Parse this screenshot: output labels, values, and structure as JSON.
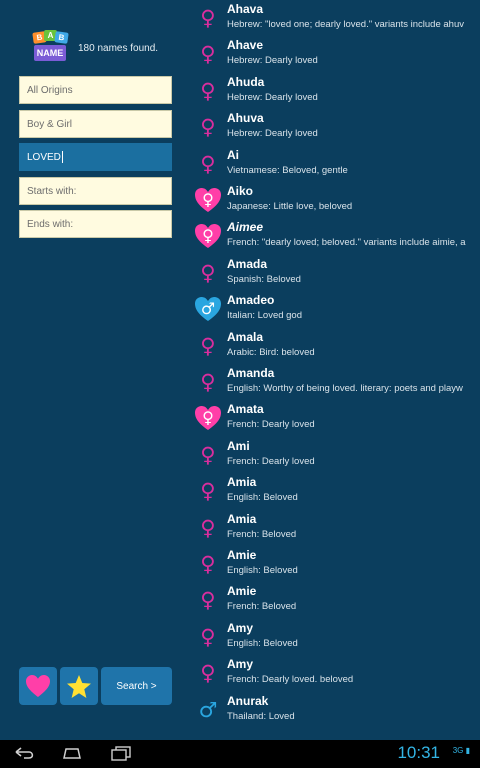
{
  "sidebar": {
    "results_text": "180 names found.",
    "logo_letters": [
      "B",
      "A",
      "B",
      "Y",
      "N",
      "A",
      "M",
      "E"
    ],
    "origin_select": "All Origins",
    "gender_select": "Boy & Girl",
    "meaning_value": "LOVED",
    "starts_placeholder": "Starts with:",
    "ends_placeholder": "Ends with:",
    "search_label": "Search >"
  },
  "names": [
    {
      "name": "Ahava",
      "desc": "Hebrew: \"loved one; dearly loved.\" variants include ahuv",
      "gender": "female",
      "fav": false
    },
    {
      "name": "Ahave",
      "desc": "Hebrew: Dearly loved",
      "gender": "female",
      "fav": false
    },
    {
      "name": "Ahuda",
      "desc": "Hebrew: Dearly loved",
      "gender": "female",
      "fav": false
    },
    {
      "name": "Ahuva",
      "desc": "Hebrew: Dearly loved",
      "gender": "female",
      "fav": false
    },
    {
      "name": "Ai",
      "desc": "Vietnamese: Beloved, gentle",
      "gender": "female",
      "fav": false
    },
    {
      "name": "Aiko",
      "desc": "Japanese: Little love, beloved",
      "gender": "female",
      "fav": true
    },
    {
      "name": "Aimee",
      "desc": "French: \"dearly loved; beloved.\" variants include aimie, a",
      "gender": "female",
      "fav": true
    },
    {
      "name": "Amada",
      "desc": "Spanish: Beloved",
      "gender": "female",
      "fav": false
    },
    {
      "name": "Amadeo",
      "desc": "Italian: Loved god",
      "gender": "male",
      "fav": true
    },
    {
      "name": "Amala",
      "desc": "Arabic: Bird: beloved",
      "gender": "female",
      "fav": false
    },
    {
      "name": "Amanda",
      "desc": "English: Worthy of being loved. literary: poets and playw",
      "gender": "female",
      "fav": false
    },
    {
      "name": "Amata",
      "desc": "French: Dearly loved",
      "gender": "female",
      "fav": true
    },
    {
      "name": "Ami",
      "desc": "French: Dearly loved",
      "gender": "female",
      "fav": false
    },
    {
      "name": "Amia",
      "desc": "English: Beloved",
      "gender": "female",
      "fav": false
    },
    {
      "name": "Amia",
      "desc": "French: Beloved",
      "gender": "female",
      "fav": false
    },
    {
      "name": "Amie",
      "desc": "English: Beloved",
      "gender": "female",
      "fav": false
    },
    {
      "name": "Amie",
      "desc": "French: Beloved",
      "gender": "female",
      "fav": false
    },
    {
      "name": "Amy",
      "desc": "English: Beloved",
      "gender": "female",
      "fav": false
    },
    {
      "name": "Amy",
      "desc": "French: Dearly loved. beloved",
      "gender": "female",
      "fav": false
    },
    {
      "name": "Anurak",
      "desc": "Thailand: Loved",
      "gender": "male",
      "fav": false
    }
  ],
  "colors": {
    "female": "#d92e9e",
    "male": "#2aa6e0",
    "fav_female": "#ff3fa8",
    "fav_male": "#2aa6e0",
    "background": "#0b3e5e"
  },
  "statusbar": {
    "time": "10:31",
    "signal": "3G"
  }
}
